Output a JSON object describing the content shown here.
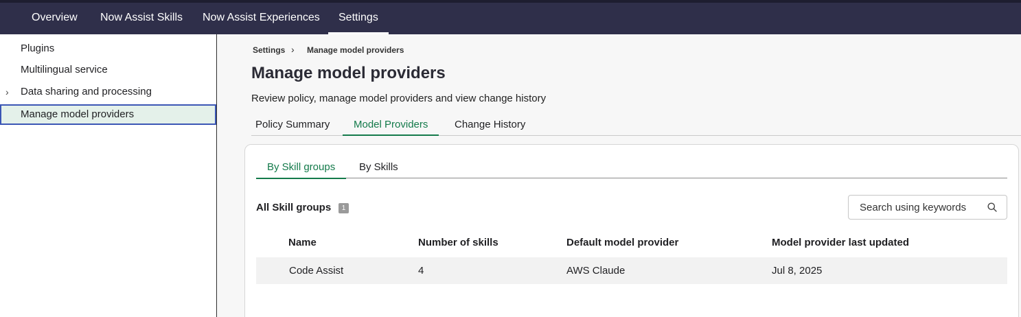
{
  "topnav": {
    "items": [
      {
        "label": "Overview"
      },
      {
        "label": "Now Assist Skills"
      },
      {
        "label": "Now Assist Experiences"
      },
      {
        "label": "Settings"
      }
    ]
  },
  "sidebar": {
    "items": [
      {
        "label": "Plugins"
      },
      {
        "label": "Multilingual service"
      },
      {
        "label": "Data sharing and processing"
      },
      {
        "label": "Manage model providers"
      }
    ]
  },
  "breadcrumb": {
    "parent": "Settings",
    "separator": "›",
    "current": "Manage model providers"
  },
  "page": {
    "title": "Manage model providers",
    "description": "Review policy, manage model providers and view change history"
  },
  "tabs": [
    {
      "label": "Policy Summary"
    },
    {
      "label": "Model Providers"
    },
    {
      "label": "Change History"
    }
  ],
  "subtabs": [
    {
      "label": "By Skill groups"
    },
    {
      "label": "By Skills"
    }
  ],
  "group": {
    "title": "All Skill groups",
    "count": "1"
  },
  "search": {
    "placeholder": "Search using keywords"
  },
  "table": {
    "columns": [
      "Name",
      "Number of skills",
      "Default model provider",
      "Model provider last updated"
    ],
    "rows": [
      [
        "Code Assist",
        "4",
        "AWS Claude",
        "Jul 8, 2025"
      ]
    ]
  },
  "colors": {
    "topbar": "#2f2f4a",
    "accent_green": "#137a4a",
    "selected_bg": "#e4f1ea",
    "selected_border": "#3b56b5"
  }
}
